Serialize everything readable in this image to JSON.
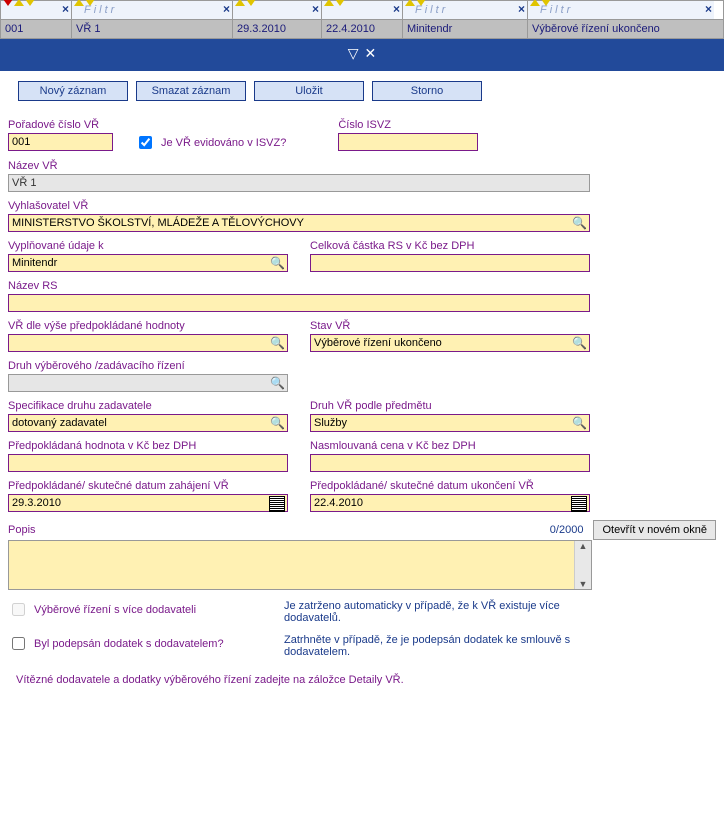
{
  "grid": {
    "filter_placeholder": "Filtr",
    "columns": [
      {
        "w": 70
      },
      {
        "w": 160
      },
      {
        "w": 88
      },
      {
        "w": 80
      },
      {
        "w": 124
      },
      {
        "w": 186
      }
    ],
    "row": {
      "c0": "001",
      "c1": "VŘ 1",
      "c2": "29.3.2010",
      "c3": "22.4.2010",
      "c4": "Minitendr",
      "c5": "Výběrové řízení ukončeno"
    }
  },
  "toolbar": {
    "new": "Nový záznam",
    "delete": "Smazat záznam",
    "save": "Uložit",
    "cancel": "Storno"
  },
  "form": {
    "poradove_label": "Pořadové číslo VŘ",
    "poradove_value": "001",
    "isvz_check_label": "Je VŘ evidováno v ISVZ?",
    "cislo_isvz_label": "Číslo ISVZ",
    "cislo_isvz_value": "",
    "nazev_vr_label": "Název VŘ",
    "nazev_vr_value": "VŘ 1",
    "vyhlasovatel_label": "Vyhlašovatel VŘ",
    "vyhlasovatel_value": "MINISTERSTVO ŠKOLSTVÍ, MLÁDEŽE A TĚLOVÝCHOVY",
    "udaje_label": "Vyplňované údaje k",
    "udaje_value": "Minitendr",
    "celkova_label": "Celková částka RS v Kč bez DPH",
    "celkova_value": "",
    "nazev_rs_label": "Název RS",
    "nazev_rs_value": "",
    "vr_hodnoty_label": "VŘ dle výše předpokládané hodnoty",
    "vr_hodnoty_value": "",
    "stav_label": "Stav VŘ",
    "stav_value": "Výběrové řízení ukončeno",
    "druh_rizeni_label": "Druh výběrového /zadávacího řízení",
    "druh_rizeni_value": "",
    "spec_label": "Specifikace druhu zadavatele",
    "spec_value": "dotovaný zadavatel",
    "druh_predmet_label": "Druh VŘ podle předmětu",
    "druh_predmet_value": "Služby",
    "predpokladana_label": "Předpokládaná hodnota v Kč bez DPH",
    "predpokladana_value": "",
    "nasmlouvana_label": "Nasmlouvaná cena v Kč bez DPH",
    "nasmlouvana_value": "",
    "datum_zahajeni_label": "Předpokládané/ skutečné datum zahájení VŘ",
    "datum_zahajeni_value": "29.3.2010",
    "datum_ukonceni_label": "Předpokládané/ skutečné datum ukončení VŘ",
    "datum_ukonceni_value": "22.4.2010",
    "popis_label": "Popis",
    "popis_counter": "0/2000",
    "popis_open": "Otevřít v novém okně",
    "vice_dodavatelu_label": "Výběrové řízení s více dodavateli",
    "vice_dodavatelu_note": "Je zatrženo automaticky v případě, že k VŘ existuje více dodavatelů.",
    "dodatek_label": "Byl podepsán dodatek s dodavatelem?",
    "dodatek_note": "Zatrhněte v případě, že je podepsán dodatek ke smlouvě s dodavatelem.",
    "footer": "Vítězné dodavatele a dodatky výběrového řízení zadejte na záložce Detaily VŘ."
  }
}
